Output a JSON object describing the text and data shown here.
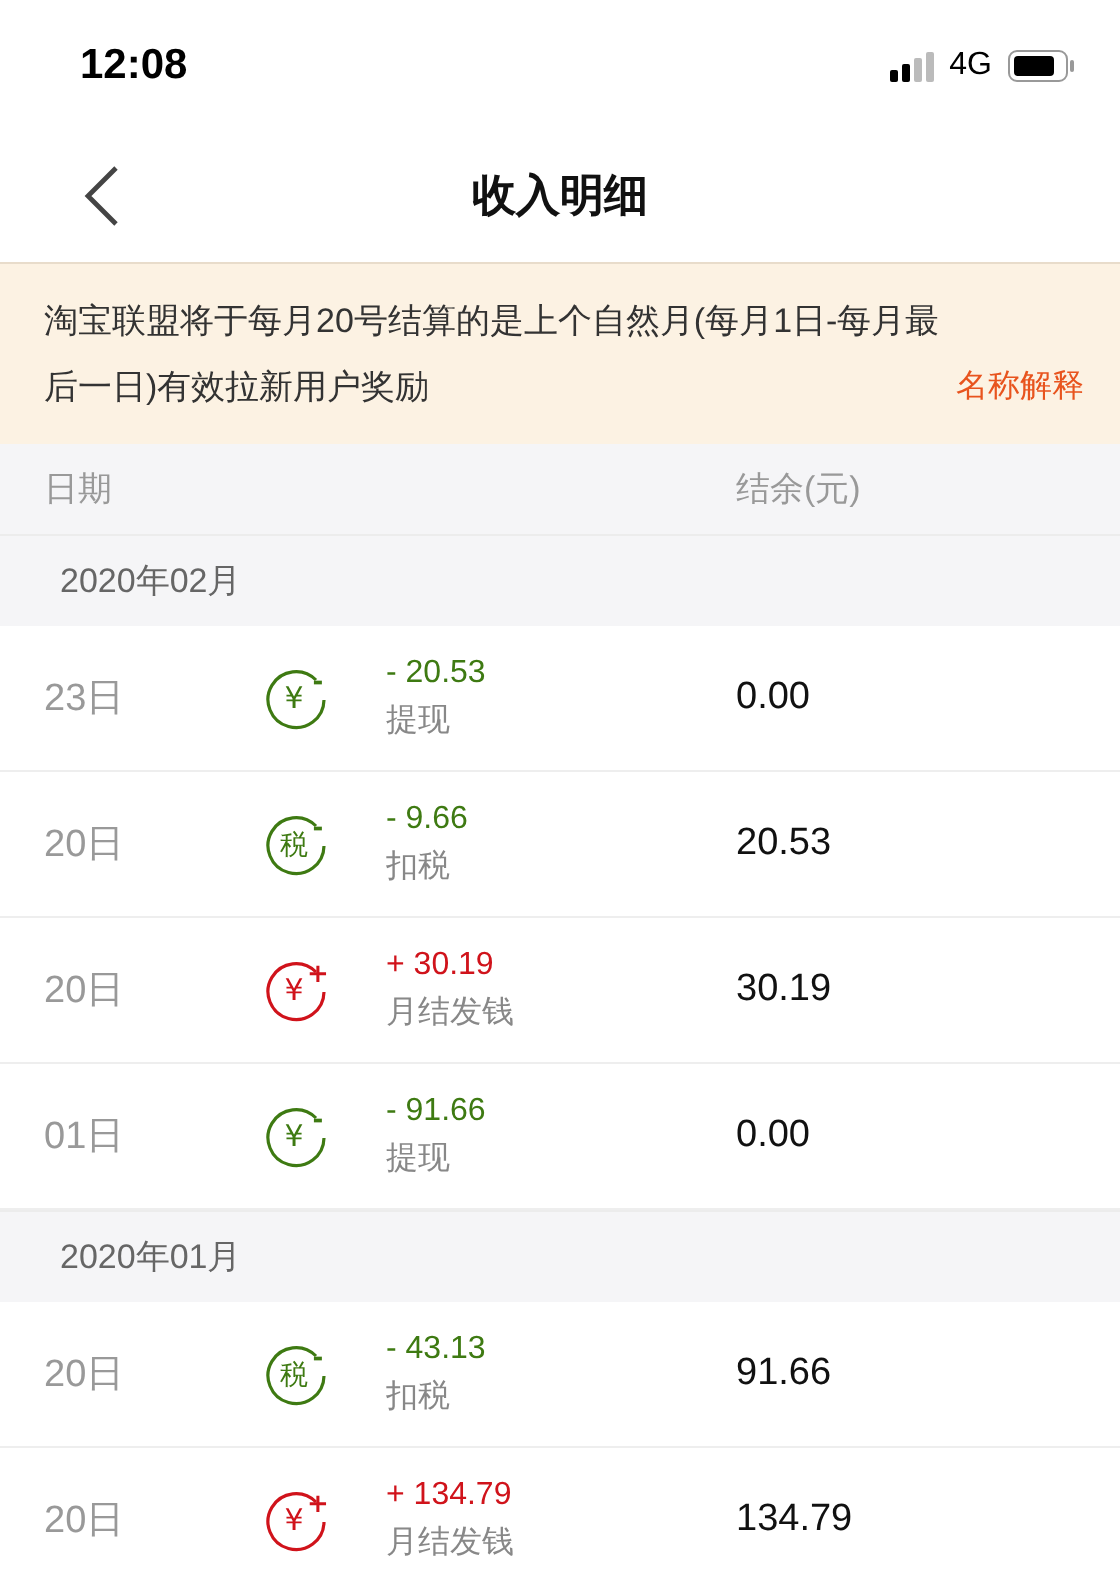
{
  "status_bar": {
    "time": "12:08",
    "network": "4G"
  },
  "nav": {
    "title": "收入明细"
  },
  "notice": {
    "text": "淘宝联盟将于每月20号结算的是上个自然月(每月1日-每月最后一日)有效拉新用户奖励",
    "link": "名称解释"
  },
  "table": {
    "columns": [
      "日期",
      "结余(元)"
    ],
    "groups": [
      {
        "month": "2020年02月",
        "rows": [
          {
            "date": "23日",
            "kind": "expense",
            "icon_char": "¥",
            "icon_sign": "-",
            "amount": "- 20.53",
            "type": "提现",
            "balance": "0.00"
          },
          {
            "date": "20日",
            "kind": "expense",
            "icon_char": "税",
            "icon_sign": "-",
            "amount": "- 9.66",
            "type": "扣税",
            "balance": "20.53"
          },
          {
            "date": "20日",
            "kind": "income",
            "icon_char": "¥",
            "icon_sign": "+",
            "amount": "+ 30.19",
            "type": "月结发钱",
            "balance": "30.19"
          },
          {
            "date": "01日",
            "kind": "expense",
            "icon_char": "¥",
            "icon_sign": "-",
            "amount": "- 91.66",
            "type": "提现",
            "balance": "0.00"
          }
        ]
      },
      {
        "month": "2020年01月",
        "rows": [
          {
            "date": "20日",
            "kind": "expense",
            "icon_char": "税",
            "icon_sign": "-",
            "amount": "- 43.13",
            "type": "扣税",
            "balance": "91.66"
          },
          {
            "date": "20日",
            "kind": "income",
            "icon_char": "¥",
            "icon_sign": "+",
            "amount": "+ 134.79",
            "type": "月结发钱",
            "balance": "134.79"
          }
        ]
      }
    ]
  }
}
